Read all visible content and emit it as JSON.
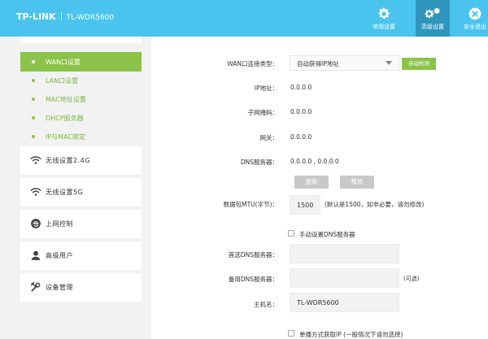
{
  "header": {
    "brand": "TP-LINK",
    "model": "TL-WDR5600",
    "nav": [
      {
        "label": "常用设置",
        "icon": "gear-icon"
      },
      {
        "label": "高级设置",
        "icon": "gears-icon"
      },
      {
        "label": "安全退出",
        "icon": "close-circle-icon"
      }
    ]
  },
  "sidebar": {
    "sub_items": [
      {
        "label": "WAN口设置"
      },
      {
        "label": "LAN口设置"
      },
      {
        "label": "MAC地址设置"
      },
      {
        "label": "DHCP服务器"
      },
      {
        "label": "IP与MAC绑定"
      }
    ],
    "main_items": [
      {
        "label": "无线设置2.4G",
        "icon": "wifi-icon"
      },
      {
        "label": "无线设置5G",
        "icon": "wifi-icon"
      },
      {
        "label": "上网控制",
        "icon": "internet-icon"
      },
      {
        "label": "高级用户",
        "icon": "user-icon"
      },
      {
        "label": "设备管理",
        "icon": "tools-icon"
      }
    ]
  },
  "form": {
    "wan_type_label": "WAN口连接类型：",
    "wan_type_value": "自动获得IP地址",
    "auto_detect_label": "自动检测",
    "ip_label": "IP地址：",
    "ip_value": "0.0.0.0",
    "mask_label": "子网掩码：",
    "mask_value": "0.0.0.0",
    "gateway_label": "网关：",
    "gateway_value": "0.0.0.0",
    "dns_label": "DNS服务器：",
    "dns_value": "0.0.0.0 , 0.0.0.0",
    "renew_label": "更新",
    "release_label": "释放",
    "mtu_label": "数据包MTU(字节)：",
    "mtu_value": "1500",
    "mtu_note": "(默认是1500，如非必要，请勿修改)",
    "manual_dns_label": "手动设置DNS服务器",
    "primary_dns_label": "首选DNS服务器：",
    "primary_dns_value": "",
    "secondary_dns_label": "备用DNS服务器：",
    "secondary_dns_value": "",
    "optional_note": "(可选)",
    "hostname_label": "主机名：",
    "hostname_value": "TL-WDR5600",
    "unicast_label": "单播方式获取IP (一般情况下请勿选择)"
  },
  "colors": {
    "header_bg": "#4ac4ee",
    "active_nav_bg": "#2f95bd",
    "accent_green": "#8bc34a"
  }
}
